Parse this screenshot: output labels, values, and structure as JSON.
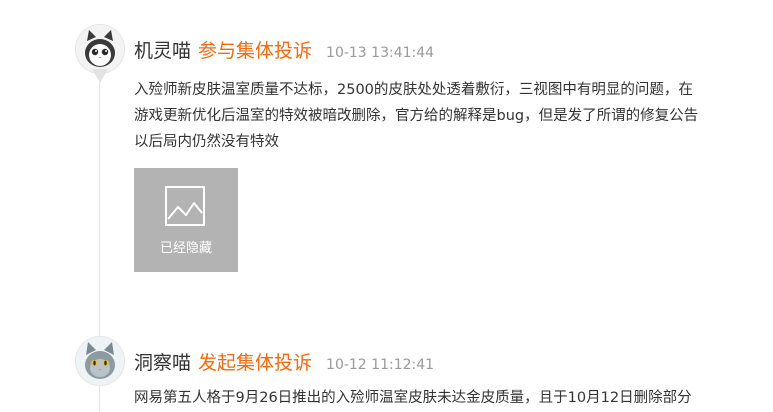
{
  "comments": [
    {
      "nickname": "机灵喵",
      "action": "参与集体投诉",
      "timestamp": "10-13 13:41:44",
      "avatar_icon": "white-cat-avatar",
      "lines": [
        "入殓师新皮肤温室质量不达标，2500的皮肤处处透着敷衍，三视图中有明显的问题，在",
        "游戏更新优化后温室的特效被暗改删除，官方给的解释是bug，但是发了所谓的修复公告",
        "以后局内仍然没有特效"
      ],
      "image": {
        "label": "已经隐藏",
        "icon": "image-icon"
      }
    },
    {
      "nickname": "洞察喵",
      "action": "发起集体投诉",
      "timestamp": "10-12 11:12:41",
      "avatar_icon": "gray-cat-avatar",
      "lines": [
        "网易第五人格于9月26日推出的入殓师温室皮肤未达金皮质量，且于10月12日删除部分"
      ]
    }
  ],
  "colors": {
    "accent": "#f06b12",
    "timestamp": "#9a9a9a",
    "placeholder": "#b3b3b3",
    "text": "#333333"
  }
}
